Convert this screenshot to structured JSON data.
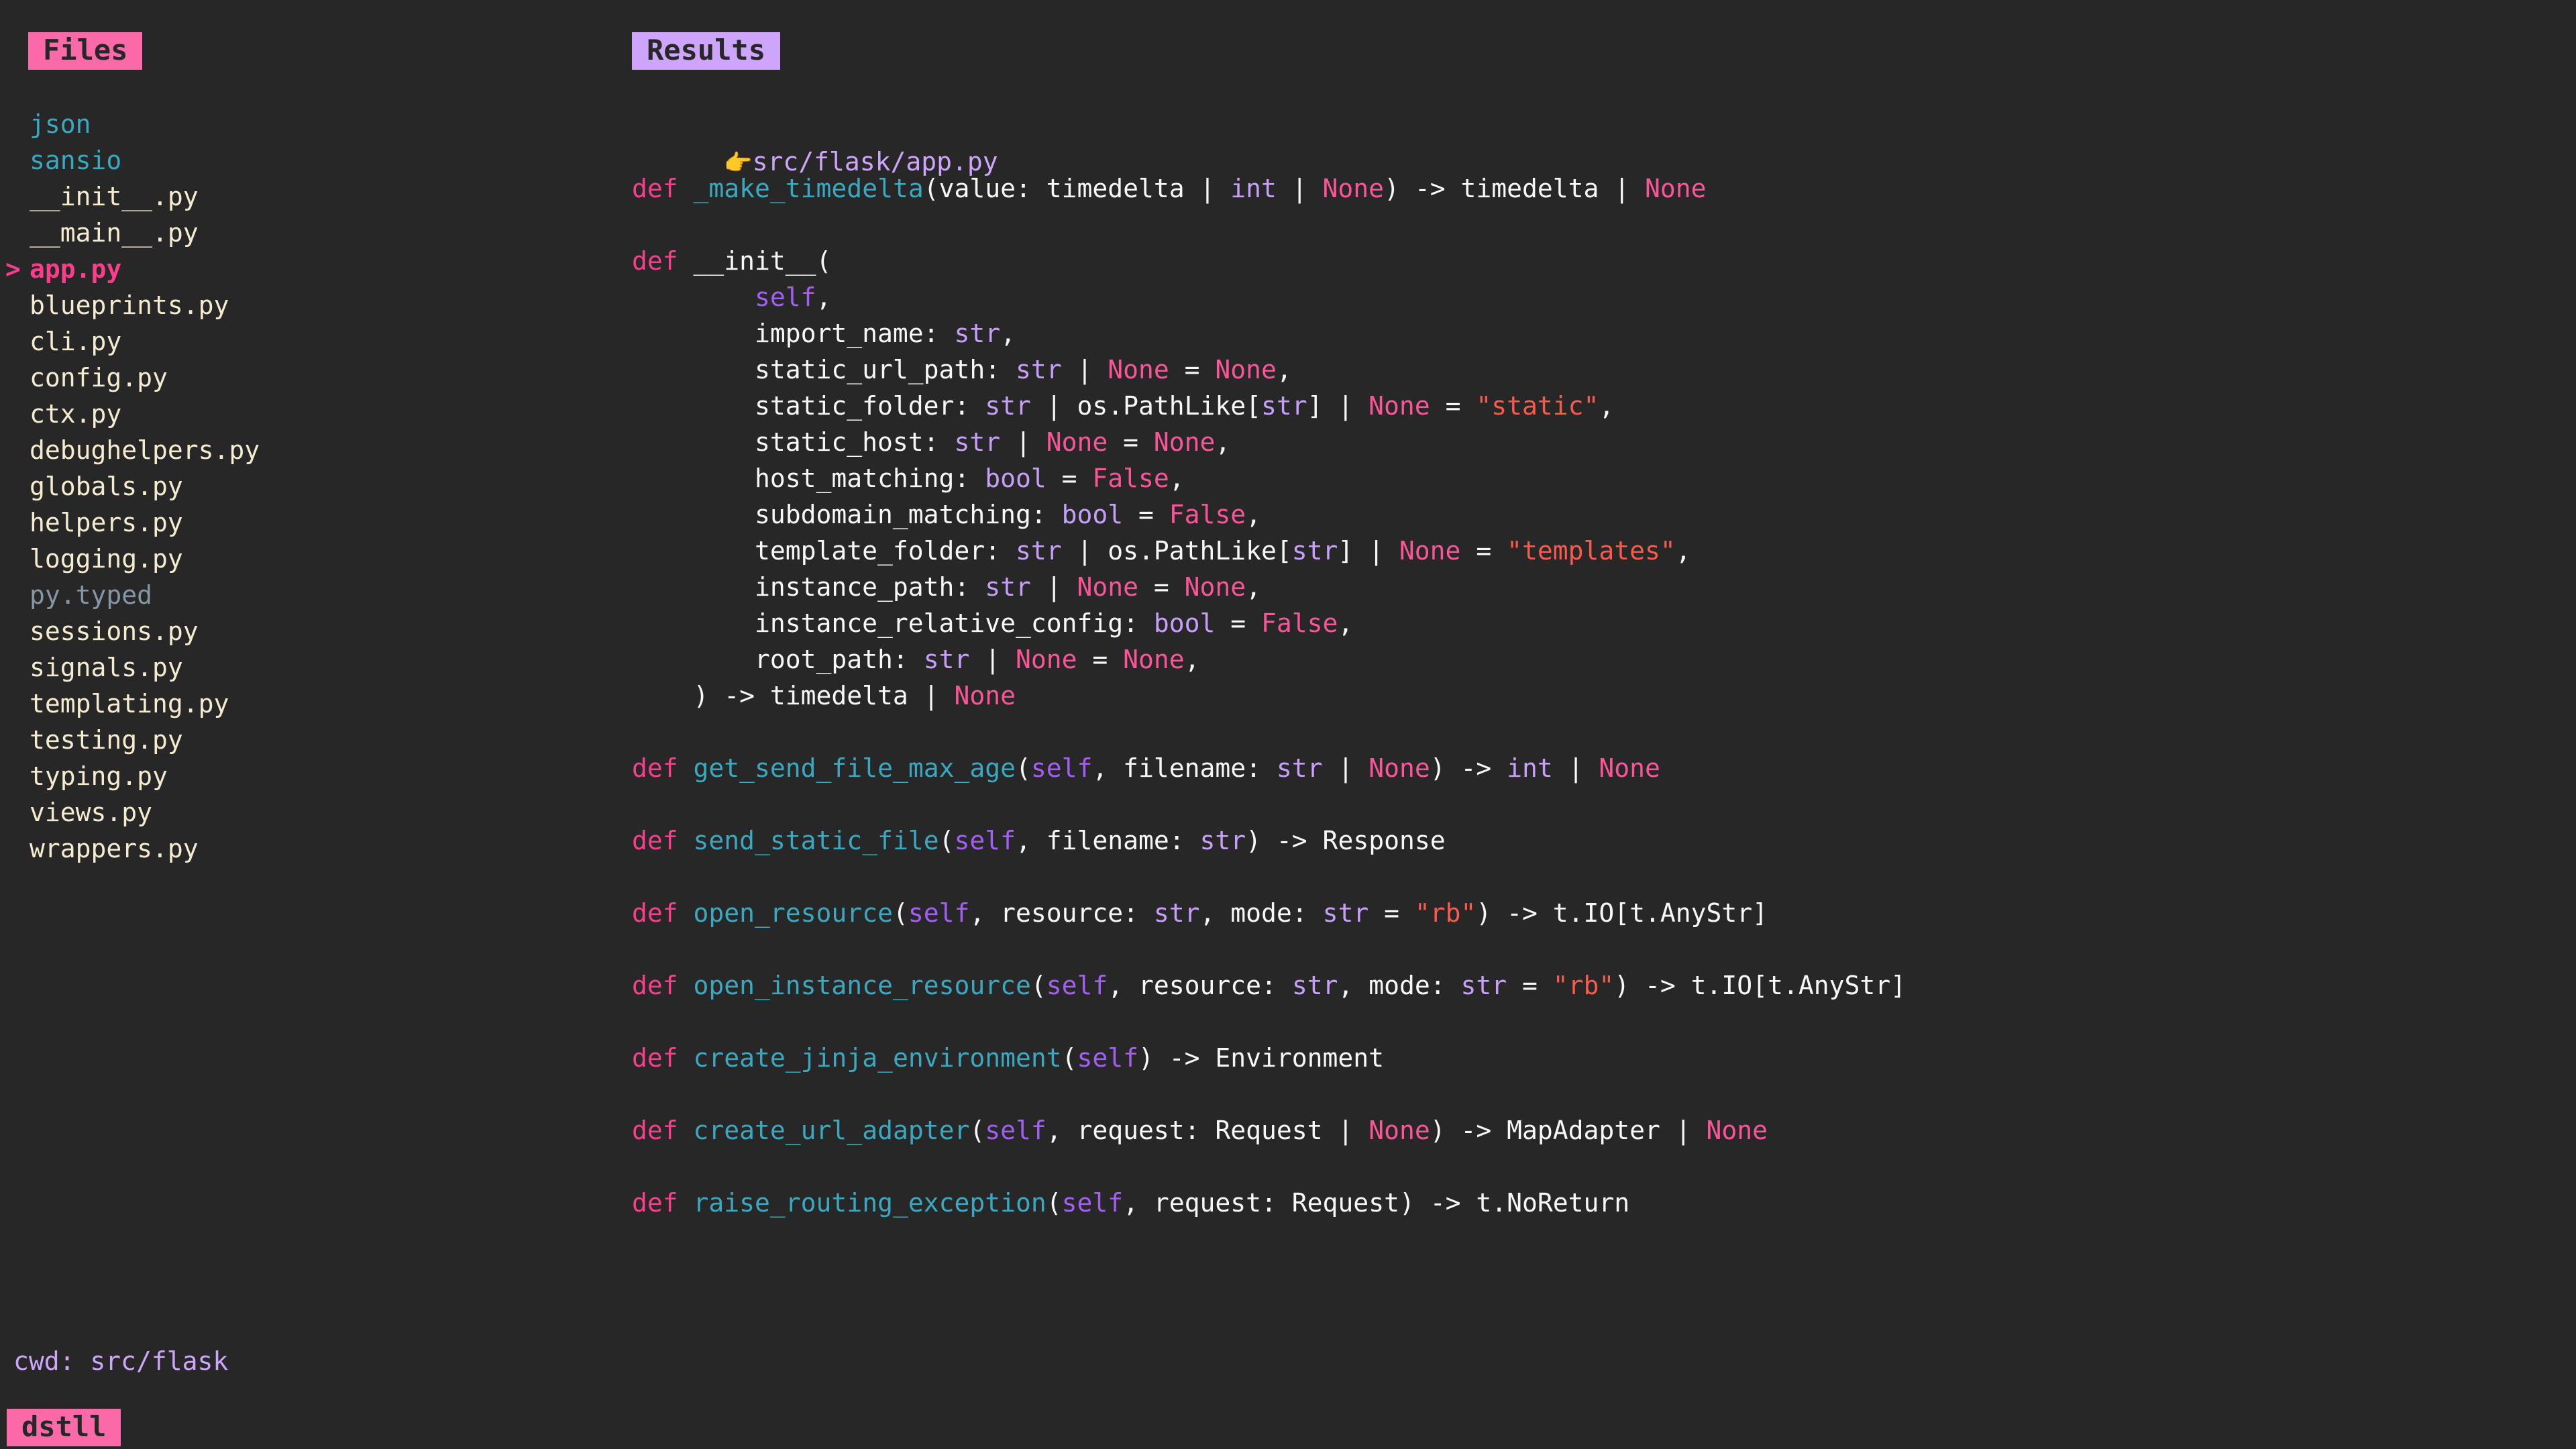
{
  "app": {
    "brand_label": "dstll",
    "background_color": "#272727"
  },
  "files_panel": {
    "header_label": "Files",
    "header_badge_color": "#fa69a8",
    "selected_marker": ">",
    "items": [
      {
        "label": "json",
        "kind": "dir",
        "selected": false
      },
      {
        "label": "sansio",
        "kind": "dir",
        "selected": false
      },
      {
        "label": "__init__.py",
        "kind": "file",
        "selected": false
      },
      {
        "label": "__main__.py",
        "kind": "file",
        "selected": false
      },
      {
        "label": "app.py",
        "kind": "selected",
        "selected": true
      },
      {
        "label": "blueprints.py",
        "kind": "file",
        "selected": false
      },
      {
        "label": "cli.py",
        "kind": "file",
        "selected": false
      },
      {
        "label": "config.py",
        "kind": "file",
        "selected": false
      },
      {
        "label": "ctx.py",
        "kind": "file",
        "selected": false
      },
      {
        "label": "debughelpers.py",
        "kind": "file",
        "selected": false
      },
      {
        "label": "globals.py",
        "kind": "file",
        "selected": false
      },
      {
        "label": "helpers.py",
        "kind": "file",
        "selected": false
      },
      {
        "label": "logging.py",
        "kind": "file",
        "selected": false
      },
      {
        "label": "py.typed",
        "kind": "muted",
        "selected": false
      },
      {
        "label": "sessions.py",
        "kind": "file",
        "selected": false
      },
      {
        "label": "signals.py",
        "kind": "file",
        "selected": false
      },
      {
        "label": "templating.py",
        "kind": "file",
        "selected": false
      },
      {
        "label": "testing.py",
        "kind": "file",
        "selected": false
      },
      {
        "label": "typing.py",
        "kind": "file",
        "selected": false
      },
      {
        "label": "views.py",
        "kind": "file",
        "selected": false
      },
      {
        "label": "wrappers.py",
        "kind": "file",
        "selected": false
      }
    ]
  },
  "results_panel": {
    "header_label": "Results",
    "header_badge_color": "#cda5fb",
    "path_icon": "👉",
    "path_label": "src/flask/app.py",
    "code_lines": [
      [
        {
          "t": "kw",
          "s": "def"
        },
        {
          "t": "plain",
          "s": " "
        },
        {
          "t": "fn",
          "s": "_make_timedelta"
        },
        {
          "t": "plain",
          "s": "(value: timedelta | "
        },
        {
          "t": "type",
          "s": "int"
        },
        {
          "t": "plain",
          "s": " | "
        },
        {
          "t": "const",
          "s": "None"
        },
        {
          "t": "plain",
          "s": ") -> timedelta | "
        },
        {
          "t": "const",
          "s": "None"
        }
      ],
      [],
      [
        {
          "t": "kw",
          "s": "def"
        },
        {
          "t": "plain",
          "s": " __init__("
        }
      ],
      [
        {
          "t": "plain",
          "s": "        "
        },
        {
          "t": "self",
          "s": "self"
        },
        {
          "t": "plain",
          "s": ","
        }
      ],
      [
        {
          "t": "plain",
          "s": "        import_name: "
        },
        {
          "t": "type",
          "s": "str"
        },
        {
          "t": "plain",
          "s": ","
        }
      ],
      [
        {
          "t": "plain",
          "s": "        static_url_path: "
        },
        {
          "t": "type",
          "s": "str"
        },
        {
          "t": "plain",
          "s": " | "
        },
        {
          "t": "const",
          "s": "None"
        },
        {
          "t": "plain",
          "s": " = "
        },
        {
          "t": "const",
          "s": "None"
        },
        {
          "t": "plain",
          "s": ","
        }
      ],
      [
        {
          "t": "plain",
          "s": "        static_folder: "
        },
        {
          "t": "type",
          "s": "str"
        },
        {
          "t": "plain",
          "s": " | os.PathLike["
        },
        {
          "t": "type",
          "s": "str"
        },
        {
          "t": "plain",
          "s": "] | "
        },
        {
          "t": "const",
          "s": "None"
        },
        {
          "t": "plain",
          "s": " = "
        },
        {
          "t": "str",
          "s": "\"static\""
        },
        {
          "t": "plain",
          "s": ","
        }
      ],
      [
        {
          "t": "plain",
          "s": "        static_host: "
        },
        {
          "t": "type",
          "s": "str"
        },
        {
          "t": "plain",
          "s": " | "
        },
        {
          "t": "const",
          "s": "None"
        },
        {
          "t": "plain",
          "s": " = "
        },
        {
          "t": "const",
          "s": "None"
        },
        {
          "t": "plain",
          "s": ","
        }
      ],
      [
        {
          "t": "plain",
          "s": "        host_matching: "
        },
        {
          "t": "type",
          "s": "bool"
        },
        {
          "t": "plain",
          "s": " = "
        },
        {
          "t": "const",
          "s": "False"
        },
        {
          "t": "plain",
          "s": ","
        }
      ],
      [
        {
          "t": "plain",
          "s": "        subdomain_matching: "
        },
        {
          "t": "type",
          "s": "bool"
        },
        {
          "t": "plain",
          "s": " = "
        },
        {
          "t": "const",
          "s": "False"
        },
        {
          "t": "plain",
          "s": ","
        }
      ],
      [
        {
          "t": "plain",
          "s": "        template_folder: "
        },
        {
          "t": "type",
          "s": "str"
        },
        {
          "t": "plain",
          "s": " | os.PathLike["
        },
        {
          "t": "type",
          "s": "str"
        },
        {
          "t": "plain",
          "s": "] | "
        },
        {
          "t": "const",
          "s": "None"
        },
        {
          "t": "plain",
          "s": " = "
        },
        {
          "t": "str",
          "s": "\"templates\""
        },
        {
          "t": "plain",
          "s": ","
        }
      ],
      [
        {
          "t": "plain",
          "s": "        instance_path: "
        },
        {
          "t": "type",
          "s": "str"
        },
        {
          "t": "plain",
          "s": " | "
        },
        {
          "t": "const",
          "s": "None"
        },
        {
          "t": "plain",
          "s": " = "
        },
        {
          "t": "const",
          "s": "None"
        },
        {
          "t": "plain",
          "s": ","
        }
      ],
      [
        {
          "t": "plain",
          "s": "        instance_relative_config: "
        },
        {
          "t": "type",
          "s": "bool"
        },
        {
          "t": "plain",
          "s": " = "
        },
        {
          "t": "const",
          "s": "False"
        },
        {
          "t": "plain",
          "s": ","
        }
      ],
      [
        {
          "t": "plain",
          "s": "        root_path: "
        },
        {
          "t": "type",
          "s": "str"
        },
        {
          "t": "plain",
          "s": " | "
        },
        {
          "t": "const",
          "s": "None"
        },
        {
          "t": "plain",
          "s": " = "
        },
        {
          "t": "const",
          "s": "None"
        },
        {
          "t": "plain",
          "s": ","
        }
      ],
      [
        {
          "t": "plain",
          "s": "    ) -> timedelta | "
        },
        {
          "t": "const",
          "s": "None"
        }
      ],
      [],
      [
        {
          "t": "kw",
          "s": "def"
        },
        {
          "t": "plain",
          "s": " "
        },
        {
          "t": "fn",
          "s": "get_send_file_max_age"
        },
        {
          "t": "plain",
          "s": "("
        },
        {
          "t": "self",
          "s": "self"
        },
        {
          "t": "plain",
          "s": ", filename: "
        },
        {
          "t": "type",
          "s": "str"
        },
        {
          "t": "plain",
          "s": " | "
        },
        {
          "t": "const",
          "s": "None"
        },
        {
          "t": "plain",
          "s": ") -> "
        },
        {
          "t": "type",
          "s": "int"
        },
        {
          "t": "plain",
          "s": " | "
        },
        {
          "t": "const",
          "s": "None"
        }
      ],
      [],
      [
        {
          "t": "kw",
          "s": "def"
        },
        {
          "t": "plain",
          "s": " "
        },
        {
          "t": "fn",
          "s": "send_static_file"
        },
        {
          "t": "plain",
          "s": "("
        },
        {
          "t": "self",
          "s": "self"
        },
        {
          "t": "plain",
          "s": ", filename: "
        },
        {
          "t": "type",
          "s": "str"
        },
        {
          "t": "plain",
          "s": ") -> Response"
        }
      ],
      [],
      [
        {
          "t": "kw",
          "s": "def"
        },
        {
          "t": "plain",
          "s": " "
        },
        {
          "t": "fn",
          "s": "open_resource"
        },
        {
          "t": "plain",
          "s": "("
        },
        {
          "t": "self",
          "s": "self"
        },
        {
          "t": "plain",
          "s": ", resource: "
        },
        {
          "t": "type",
          "s": "str"
        },
        {
          "t": "plain",
          "s": ", mode: "
        },
        {
          "t": "type",
          "s": "str"
        },
        {
          "t": "plain",
          "s": " = "
        },
        {
          "t": "str",
          "s": "\"rb\""
        },
        {
          "t": "plain",
          "s": ") -> t.IO[t.AnyStr]"
        }
      ],
      [],
      [
        {
          "t": "kw",
          "s": "def"
        },
        {
          "t": "plain",
          "s": " "
        },
        {
          "t": "fn",
          "s": "open_instance_resource"
        },
        {
          "t": "plain",
          "s": "("
        },
        {
          "t": "self",
          "s": "self"
        },
        {
          "t": "plain",
          "s": ", resource: "
        },
        {
          "t": "type",
          "s": "str"
        },
        {
          "t": "plain",
          "s": ", mode: "
        },
        {
          "t": "type",
          "s": "str"
        },
        {
          "t": "plain",
          "s": " = "
        },
        {
          "t": "str",
          "s": "\"rb\""
        },
        {
          "t": "plain",
          "s": ") -> t.IO[t.AnyStr]"
        }
      ],
      [],
      [
        {
          "t": "kw",
          "s": "def"
        },
        {
          "t": "plain",
          "s": " "
        },
        {
          "t": "fn",
          "s": "create_jinja_environment"
        },
        {
          "t": "plain",
          "s": "("
        },
        {
          "t": "self",
          "s": "self"
        },
        {
          "t": "plain",
          "s": ") -> Environment"
        }
      ],
      [],
      [
        {
          "t": "kw",
          "s": "def"
        },
        {
          "t": "plain",
          "s": " "
        },
        {
          "t": "fn",
          "s": "create_url_adapter"
        },
        {
          "t": "plain",
          "s": "("
        },
        {
          "t": "self",
          "s": "self"
        },
        {
          "t": "plain",
          "s": ", request: Request | "
        },
        {
          "t": "const",
          "s": "None"
        },
        {
          "t": "plain",
          "s": ") -> MapAdapter | "
        },
        {
          "t": "const",
          "s": "None"
        }
      ],
      [],
      [
        {
          "t": "kw",
          "s": "def"
        },
        {
          "t": "plain",
          "s": " "
        },
        {
          "t": "fn",
          "s": "raise_routing_exception"
        },
        {
          "t": "plain",
          "s": "("
        },
        {
          "t": "self",
          "s": "self"
        },
        {
          "t": "plain",
          "s": ", request: Request) -> t.NoReturn"
        }
      ]
    ]
  },
  "footer": {
    "cwd_label": "cwd: src/flask"
  }
}
